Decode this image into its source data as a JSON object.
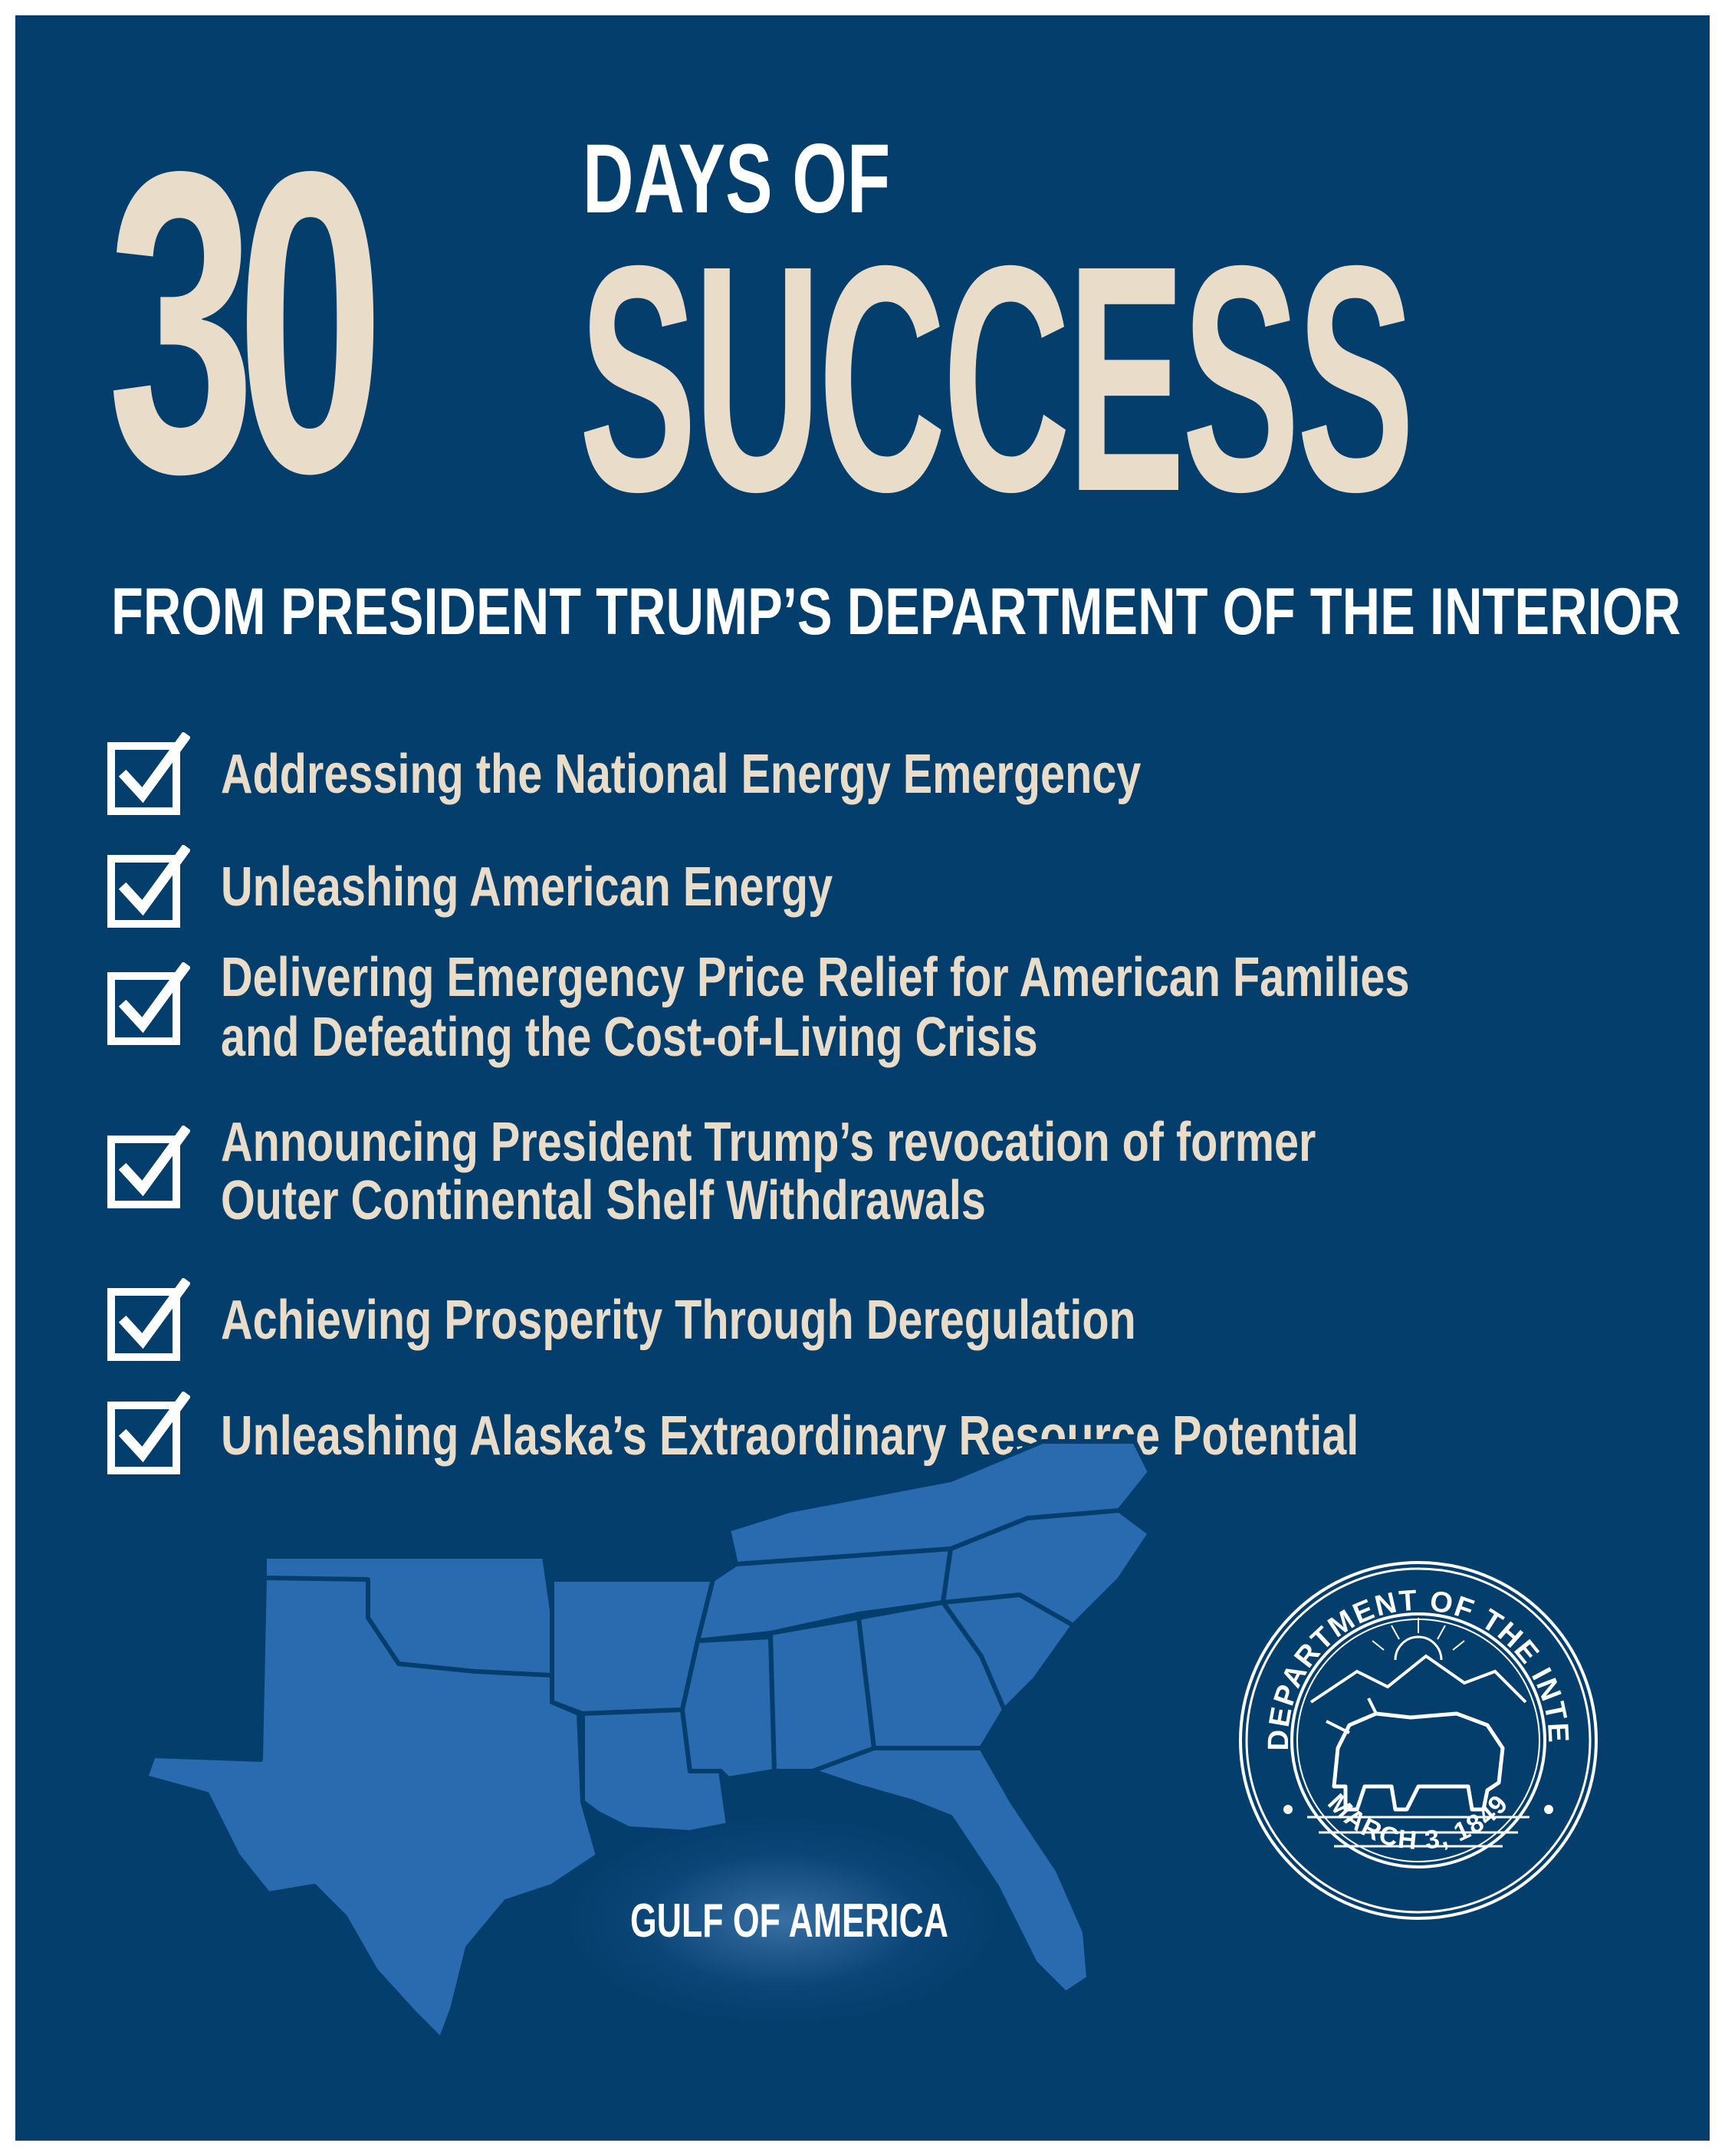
{
  "header": {
    "number": "30",
    "days_of": "DAYS OF",
    "success": "SUCCESS",
    "subtitle": "FROM PRESIDENT TRUMP’S DEPARTMENT OF THE INTERIOR"
  },
  "checklist": {
    "items": [
      {
        "lines": [
          "Addressing the National Energy Emergency"
        ]
      },
      {
        "lines": [
          "Unleashing American Energy"
        ]
      },
      {
        "lines": [
          "Delivering Emergency Price Relief for American Families",
          "and Defeating the Cost-of-Living Crisis"
        ]
      },
      {
        "lines": [
          "Announcing President Trump’s revocation of former",
          "Outer Continental Shelf Withdrawals"
        ]
      },
      {
        "lines": [
          "Achieving Prosperity Through Deregulation"
        ]
      },
      {
        "lines": [
          "Unleashing Alaska’s Extraordinary Resource Potential"
        ]
      }
    ]
  },
  "map": {
    "gulf_label": "GULF OF AMERICA"
  },
  "seal": {
    "top_text": "U.S. DEPARTMENT OF THE INTERIOR",
    "bottom_text": "MARCH 3, 1849"
  },
  "colors": {
    "background": "#033e6d",
    "accent": "#e9dcc8",
    "map_fill": "#2a6aaf",
    "white": "#ffffff"
  }
}
